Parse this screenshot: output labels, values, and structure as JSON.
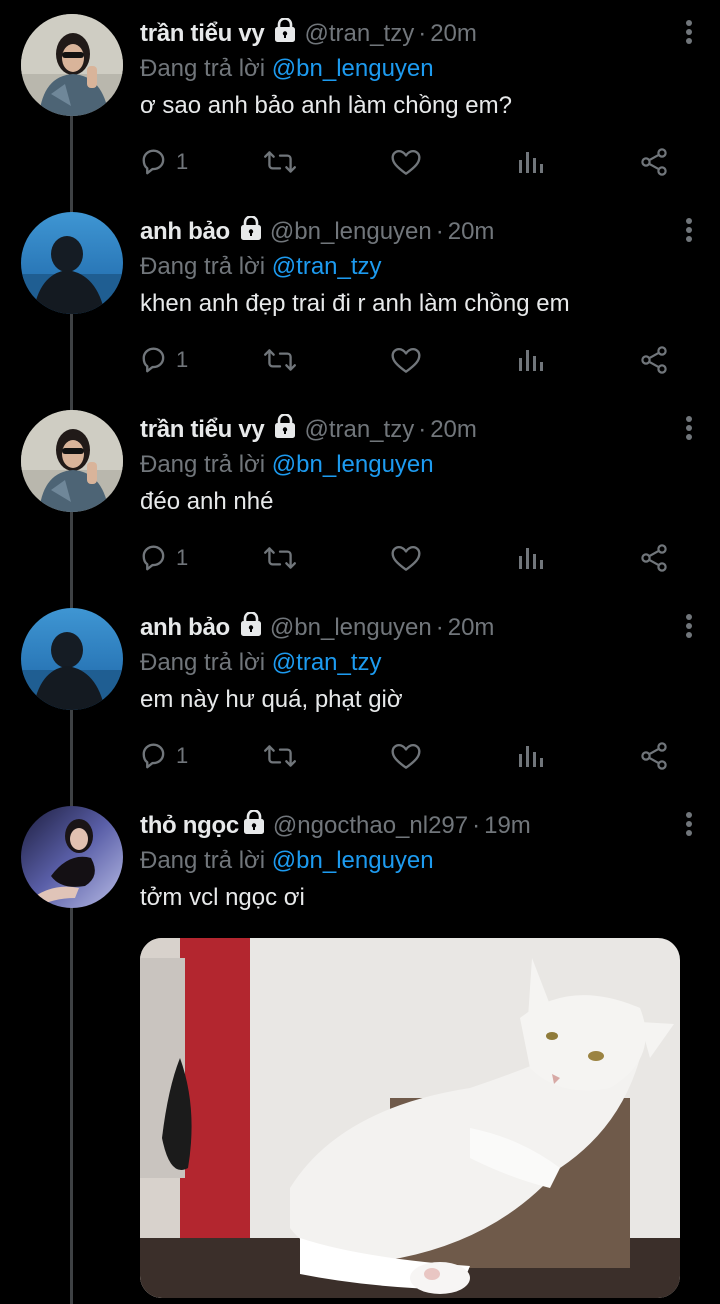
{
  "tweets": [
    {
      "name": "trần tiểu vy",
      "handle": "@tran_tzy",
      "time": "20m",
      "replying_label": "Đang trả lời",
      "replying_to": "@bn_lenguyen",
      "text": "ơ sao anh bảo anh làm chồng em?",
      "reply_count": "1"
    },
    {
      "name": "anh bảo",
      "handle": "@bn_lenguyen",
      "time": "20m",
      "replying_label": "Đang trả lời",
      "replying_to": "@tran_tzy",
      "text": "khen anh đẹp trai đi r anh làm chồng em",
      "reply_count": "1"
    },
    {
      "name": "trần tiểu vy",
      "handle": "@tran_tzy",
      "time": "20m",
      "replying_label": "Đang trả lời",
      "replying_to": "@bn_lenguyen",
      "text": "đéo anh nhé",
      "reply_count": "1"
    },
    {
      "name": "anh bảo",
      "handle": "@bn_lenguyen",
      "time": "20m",
      "replying_label": "Đang trả lời",
      "replying_to": "@tran_tzy",
      "text": "em này hư quá, phạt giờ",
      "reply_count": "1"
    },
    {
      "name": "thỏ ngọc",
      "handle": "@ngocthao_nl297",
      "time": "19m",
      "replying_label": "Đang trả lời",
      "replying_to": "@bn_lenguyen",
      "text": "tởm vcl ngọc ơi"
    }
  ],
  "separator": "·",
  "colors": {
    "background": "#000000",
    "text": "#e7e9ea",
    "muted": "#71767b",
    "link": "#1d9bf0",
    "thread_line": "#3e4144"
  },
  "icons": {
    "lock": "lock-icon",
    "more": "more-vertical-icon",
    "reply": "reply-icon",
    "retweet": "retweet-icon",
    "like": "heart-icon",
    "views": "views-icon",
    "share": "share-icon"
  }
}
